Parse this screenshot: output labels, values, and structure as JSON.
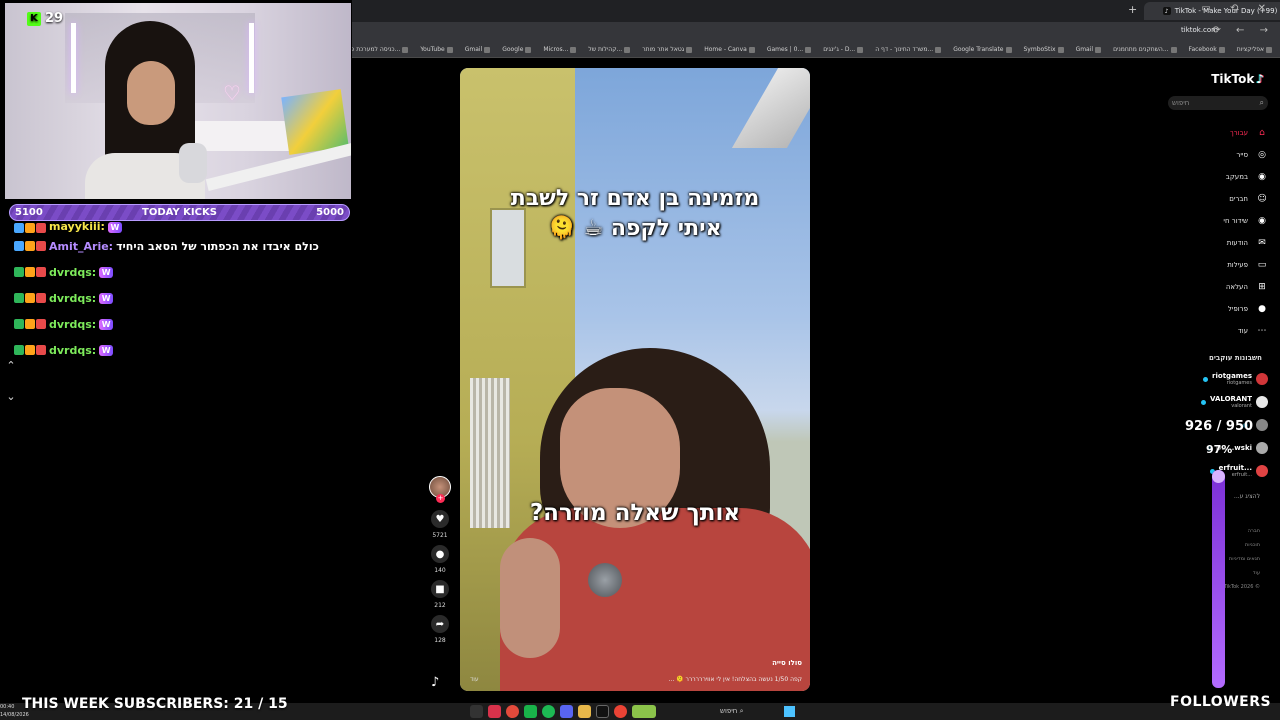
{
  "browser": {
    "active_tab_title": "(99+) TikTok - Make Your Day",
    "url": "tiktok.com",
    "bookmarks": [
      "אפליקציות",
      "Facebook",
      "השחקנים מתחמנים...",
      "Gmail",
      "SymboStix",
      "Google Translate",
      "משרד החינוך - דף ה...",
      "ג'ינגים - D...",
      "Games | 0...",
      "Home - Canva",
      "גטאל אתר מותר",
      "קהילות של...",
      "Micros...",
      "Google",
      "Gmail",
      "YouTube",
      "כניסה למערכת פוב...",
      "קורס דיגיטלי"
    ]
  },
  "stream": {
    "kick_count": "29",
    "kicks_goal": {
      "left": "5100",
      "label": "TODAY KICKS",
      "right": "5000"
    },
    "chat": [
      {
        "user": "mayykiii:",
        "text": "",
        "color": "yellow"
      },
      {
        "user": "Amit_Arie:",
        "text": "כולם איבדו את הכפתור של הסאב היחיד",
        "color": "purple"
      },
      {
        "user": "dvrdqs:",
        "text": "",
        "color": "green"
      },
      {
        "user": "dvrdqs:",
        "text": "",
        "color": "green"
      },
      {
        "user": "dvrdqs:",
        "text": "",
        "color": "green"
      },
      {
        "user": "dvrdqs:",
        "text": "",
        "color": "green"
      }
    ],
    "subscribers_label": "THIS WEEK SUBSCRIBERS: 21 / 15",
    "followers_label": "FOLLOWERS",
    "followers_count": "926 / 950",
    "followers_percent": "97%"
  },
  "video": {
    "caption_top_line1": "מזמינה בן אדם זר לשבת",
    "caption_top_line2": "איתי לקפה ☕ 🫠",
    "caption_bottom": "אותך שאלה מוזרה?",
    "author": "סולו סייה",
    "description": "קפה 1/50 נעשה בהצלחה! אין לי אווירררררר 🫠 ...",
    "more": "עוד"
  },
  "actions": [
    {
      "name": "like",
      "count": "5721",
      "icon": "♥"
    },
    {
      "name": "comment",
      "count": "140",
      "icon": "●"
    },
    {
      "name": "save",
      "count": "212",
      "icon": "■"
    },
    {
      "name": "share",
      "count": "128",
      "icon": "➦"
    }
  ],
  "tiktok": {
    "logo": "TikTok",
    "search_placeholder": "חיפוש",
    "nav": [
      {
        "label": "עבורך",
        "icon": "⌂",
        "active": true
      },
      {
        "label": "סייר",
        "icon": "◎",
        "active": false
      },
      {
        "label": "במעקב",
        "icon": "◉",
        "active": false
      },
      {
        "label": "חברים",
        "icon": "☺",
        "active": false
      },
      {
        "label": "שידור חי",
        "icon": "◉",
        "active": false
      },
      {
        "label": "הודעות",
        "icon": "✉",
        "active": false
      },
      {
        "label": "פעילות",
        "icon": "▭",
        "active": false
      },
      {
        "label": "העלאה",
        "icon": "⊞",
        "active": false
      },
      {
        "label": "פרופיל",
        "icon": "●",
        "active": false
      },
      {
        "label": "עוד",
        "icon": "⋯",
        "active": false
      }
    ],
    "following_title": "חשבונות עוקבים",
    "following": [
      {
        "name": "riotgames",
        "sub": "riotgames",
        "color": "#d13639"
      },
      {
        "name": "VALORANT",
        "sub": "valorant",
        "color": "#e8e8e8"
      },
      {
        "name": "",
        "sub": "",
        "color": "#888"
      },
      {
        "name": "Da...wski",
        "sub": "",
        "color": "#aaa"
      },
      {
        "name": "...erfruit",
        "sub": "...erfruit",
        "color": "#e04343"
      }
    ],
    "show_more": "להציג ע...",
    "footer": [
      "חברה",
      "תוכניות",
      "תנאים ומדיניות",
      "עוד",
      "© 2026 TikTok"
    ]
  },
  "taskbar": {
    "time": "00:40",
    "date": "14/08/2026",
    "search": "חיפוש"
  }
}
